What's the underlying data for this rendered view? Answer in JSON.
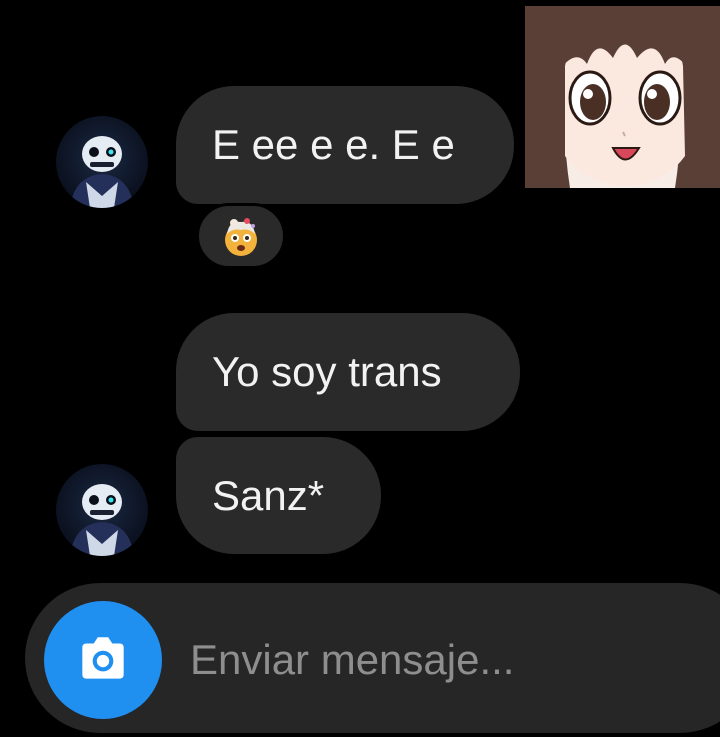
{
  "messages": [
    {
      "text": "E ee e e. E e"
    },
    {
      "text": "Yo soy trans"
    },
    {
      "text": "Sanz*"
    }
  ],
  "reaction": {
    "icon": "exploding-head-emoji"
  },
  "composer": {
    "placeholder": "Enviar mensaje...",
    "camera_icon": "camera-icon",
    "accent_color": "#1f8ff0"
  },
  "colors": {
    "background": "#000000",
    "bubble": "#2a2a2a",
    "bubble_text": "#f2f2f2",
    "placeholder_text": "#8e8e8e"
  }
}
